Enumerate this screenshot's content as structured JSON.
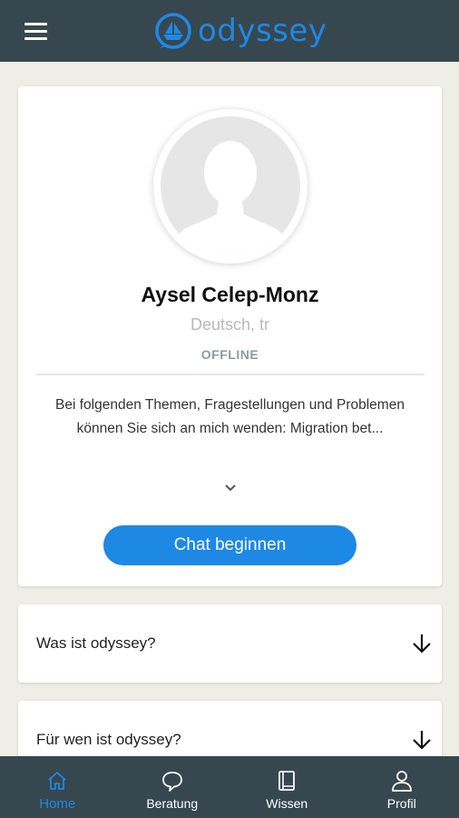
{
  "header": {
    "app_name": "odyssey",
    "menu_icon": "hamburger-menu-icon",
    "logo_icon": "odyssey-boat-logo-icon",
    "brand_color": "#1e88e5",
    "bar_color": "#37474f"
  },
  "profile": {
    "avatar_icon": "person-silhouette-icon",
    "name": "Aysel Celep-Monz",
    "languages": "Deutsch, tr",
    "status": "OFFLINE",
    "description": "Bei folgenden Themen, Fragestellungen und Problemen können Sie sich an mich wenden: Migration bet...",
    "expand_icon": "chevron-down-icon",
    "chat_button": "Chat beginnen"
  },
  "faq": [
    {
      "question": "Was ist odyssey?",
      "icon": "arrow-down-icon"
    },
    {
      "question": "Für wen ist odyssey?",
      "icon": "arrow-down-icon"
    }
  ],
  "bottom_nav": [
    {
      "label": "Home",
      "icon": "home-icon",
      "active": true
    },
    {
      "label": "Beratung",
      "icon": "chat-bubble-icon",
      "active": false
    },
    {
      "label": "Wissen",
      "icon": "book-icon",
      "active": false
    },
    {
      "label": "Profil",
      "icon": "user-icon",
      "active": false
    }
  ]
}
